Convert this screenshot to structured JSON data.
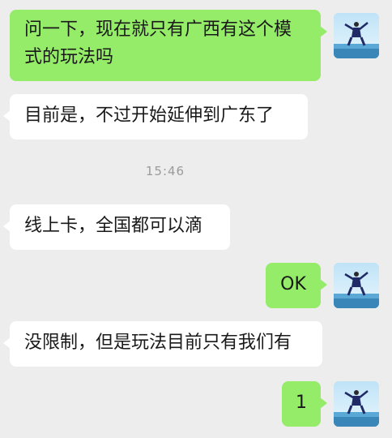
{
  "conversation": {
    "messages": [
      {
        "side": "out",
        "text": "问一下，现在就只有广西有这个模式的玩法吗"
      },
      {
        "side": "in",
        "text": "目前是，不过开始延伸到广东了"
      },
      {
        "side": "in",
        "text": "线上卡，全国都可以滴"
      },
      {
        "side": "out",
        "text": "OK"
      },
      {
        "side": "in",
        "text": "没限制，但是玩法目前只有我们有"
      },
      {
        "side": "out",
        "text": "1"
      }
    ],
    "timestamp": "15:46"
  },
  "colors": {
    "background": "#ededed",
    "outgoing_bubble": "#95ec69",
    "incoming_bubble": "#ffffff",
    "timestamp_text": "#9b9b9b"
  }
}
